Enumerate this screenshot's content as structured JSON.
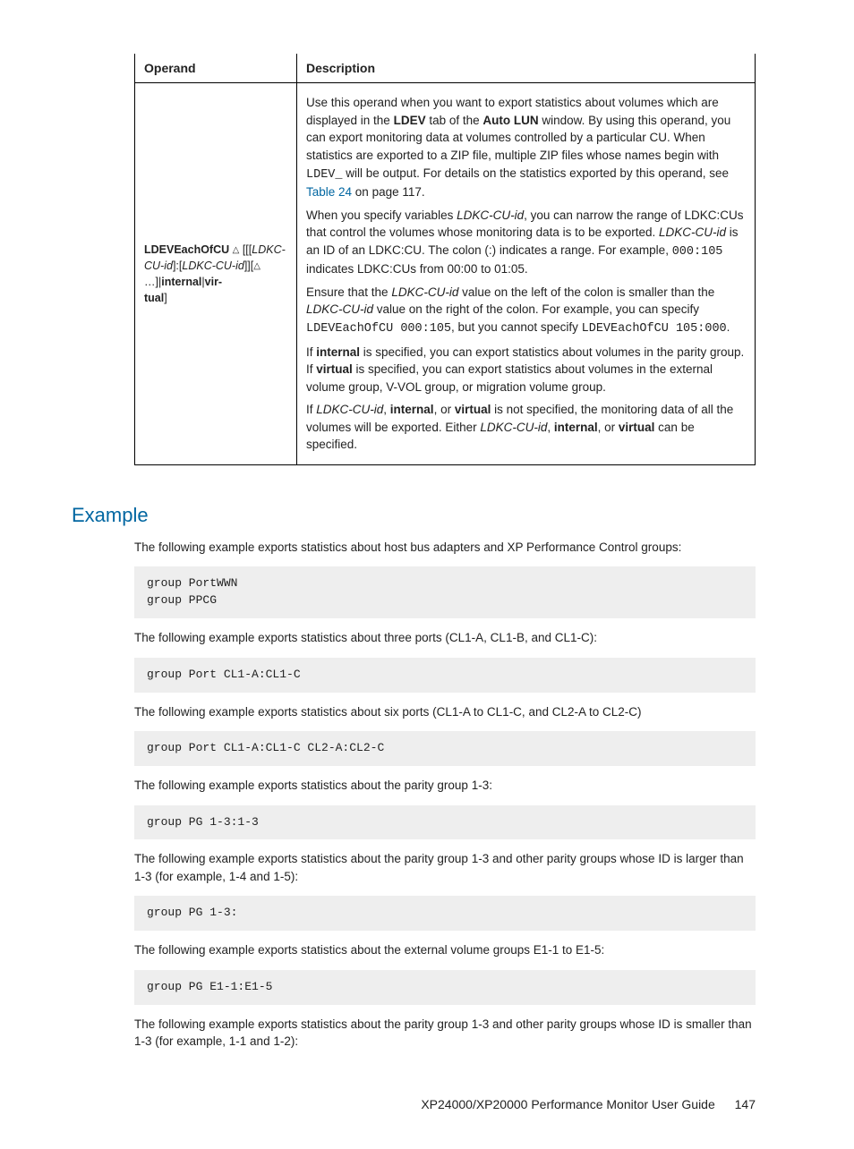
{
  "table": {
    "headers": {
      "operand": "Operand",
      "description": "Description"
    },
    "operand": {
      "name_b": "LDEVEachOfCU",
      "frag1_i": "LDKC-CU-id",
      "frag2_i": "LDKC-CU-id",
      "frag3_b": "internal",
      "frag4_b": "virtual"
    },
    "desc": {
      "p1_a": "Use this operand when you want to export statistics about volumes which are displayed in the ",
      "p1_b": "LDEV",
      "p1_c": " tab of the ",
      "p1_d": "Auto LUN",
      "p1_e": " window. By using this operand, you can export monitoring data at volumes controlled by a particular CU. When statistics are exported to a ZIP file, multiple ZIP files whose names begin with ",
      "p1_f": "LDEV_",
      "p1_g": " will be output. For details on the statistics exported by this operand, see ",
      "p1_link": "Table 24",
      "p1_h": " on page 117.",
      "p2_a": "When you specify variables ",
      "p2_b": "LDKC-CU-id",
      "p2_c": ", you can narrow the range of LDKC:CUs that control the volumes whose monitoring data is to be exported. ",
      "p2_d": "LDKC-CU-id",
      "p2_e": " is an ID of an LDKC:CU. The colon (:) indicates a range. For example, ",
      "p2_f": "000:105",
      "p2_g": " indicates LDKC:CUs from 00:00 to 01:05.",
      "p3_a": "Ensure that the ",
      "p3_b": "LDKC-CU-id",
      "p3_c": " value on the left of the colon is smaller than the ",
      "p3_d": "LDKC-CU-id",
      "p3_e": " value on the right of the colon. For example, you can specify ",
      "p3_f": "LDEVEachOfCU 000:105",
      "p3_g": ", but you cannot specify ",
      "p3_h": "LDEVEachOfCU 105:000",
      "p3_i": ".",
      "p4_a": "If ",
      "p4_b": "internal",
      "p4_c": " is specified, you can export statistics about volumes in the parity group. If ",
      "p4_d": "virtual",
      "p4_e": " is specified, you can export statistics about volumes in the external volume group, V-VOL group, or migration volume group.",
      "p5_a": "If ",
      "p5_b": "LDKC-CU-id",
      "p5_c": ", ",
      "p5_d": "internal",
      "p5_e": ", or ",
      "p5_f": "virtual",
      "p5_g": " is not specified, the monitoring data of all the volumes will be exported. Either ",
      "p5_h": "LDKC-CU-id",
      "p5_i": ", ",
      "p5_j": "internal",
      "p5_k": ", or ",
      "p5_l": "virtual",
      "p5_m": " can be specified."
    }
  },
  "example_heading": "Example",
  "texts": {
    "t1": "The following example exports statistics about host bus adapters and XP Performance Control groups:",
    "t2": "The following example exports statistics about three ports (CL1-A, CL1-B, and CL1-C):",
    "t3": "The following example exports statistics about six ports (CL1-A to CL1-C, and CL2-A to CL2-C)",
    "t4": "The following example exports statistics about the parity group 1-3:",
    "t5": "The following example exports statistics about the parity group 1-3 and other parity groups whose ID is larger than 1-3 (for example, 1-4 and 1-5):",
    "t6": "The following example exports statistics about the external volume groups E1-1 to E1-5:",
    "t7": "The following example exports statistics about the parity group 1-3 and other parity groups whose ID is smaller than 1-3 (for example, 1-1 and 1-2):"
  },
  "codes": {
    "c1": "group PortWWN\ngroup PPCG",
    "c2": "group Port CL1-A:CL1-C",
    "c3": "group Port CL1-A:CL1-C CL2-A:CL2-C",
    "c4": "group PG 1-3:1-3",
    "c5": "group PG 1-3:",
    "c6": "group PG E1-1:E1-5"
  },
  "footer": {
    "title": "XP24000/XP20000 Performance Monitor User Guide",
    "page": "147"
  }
}
